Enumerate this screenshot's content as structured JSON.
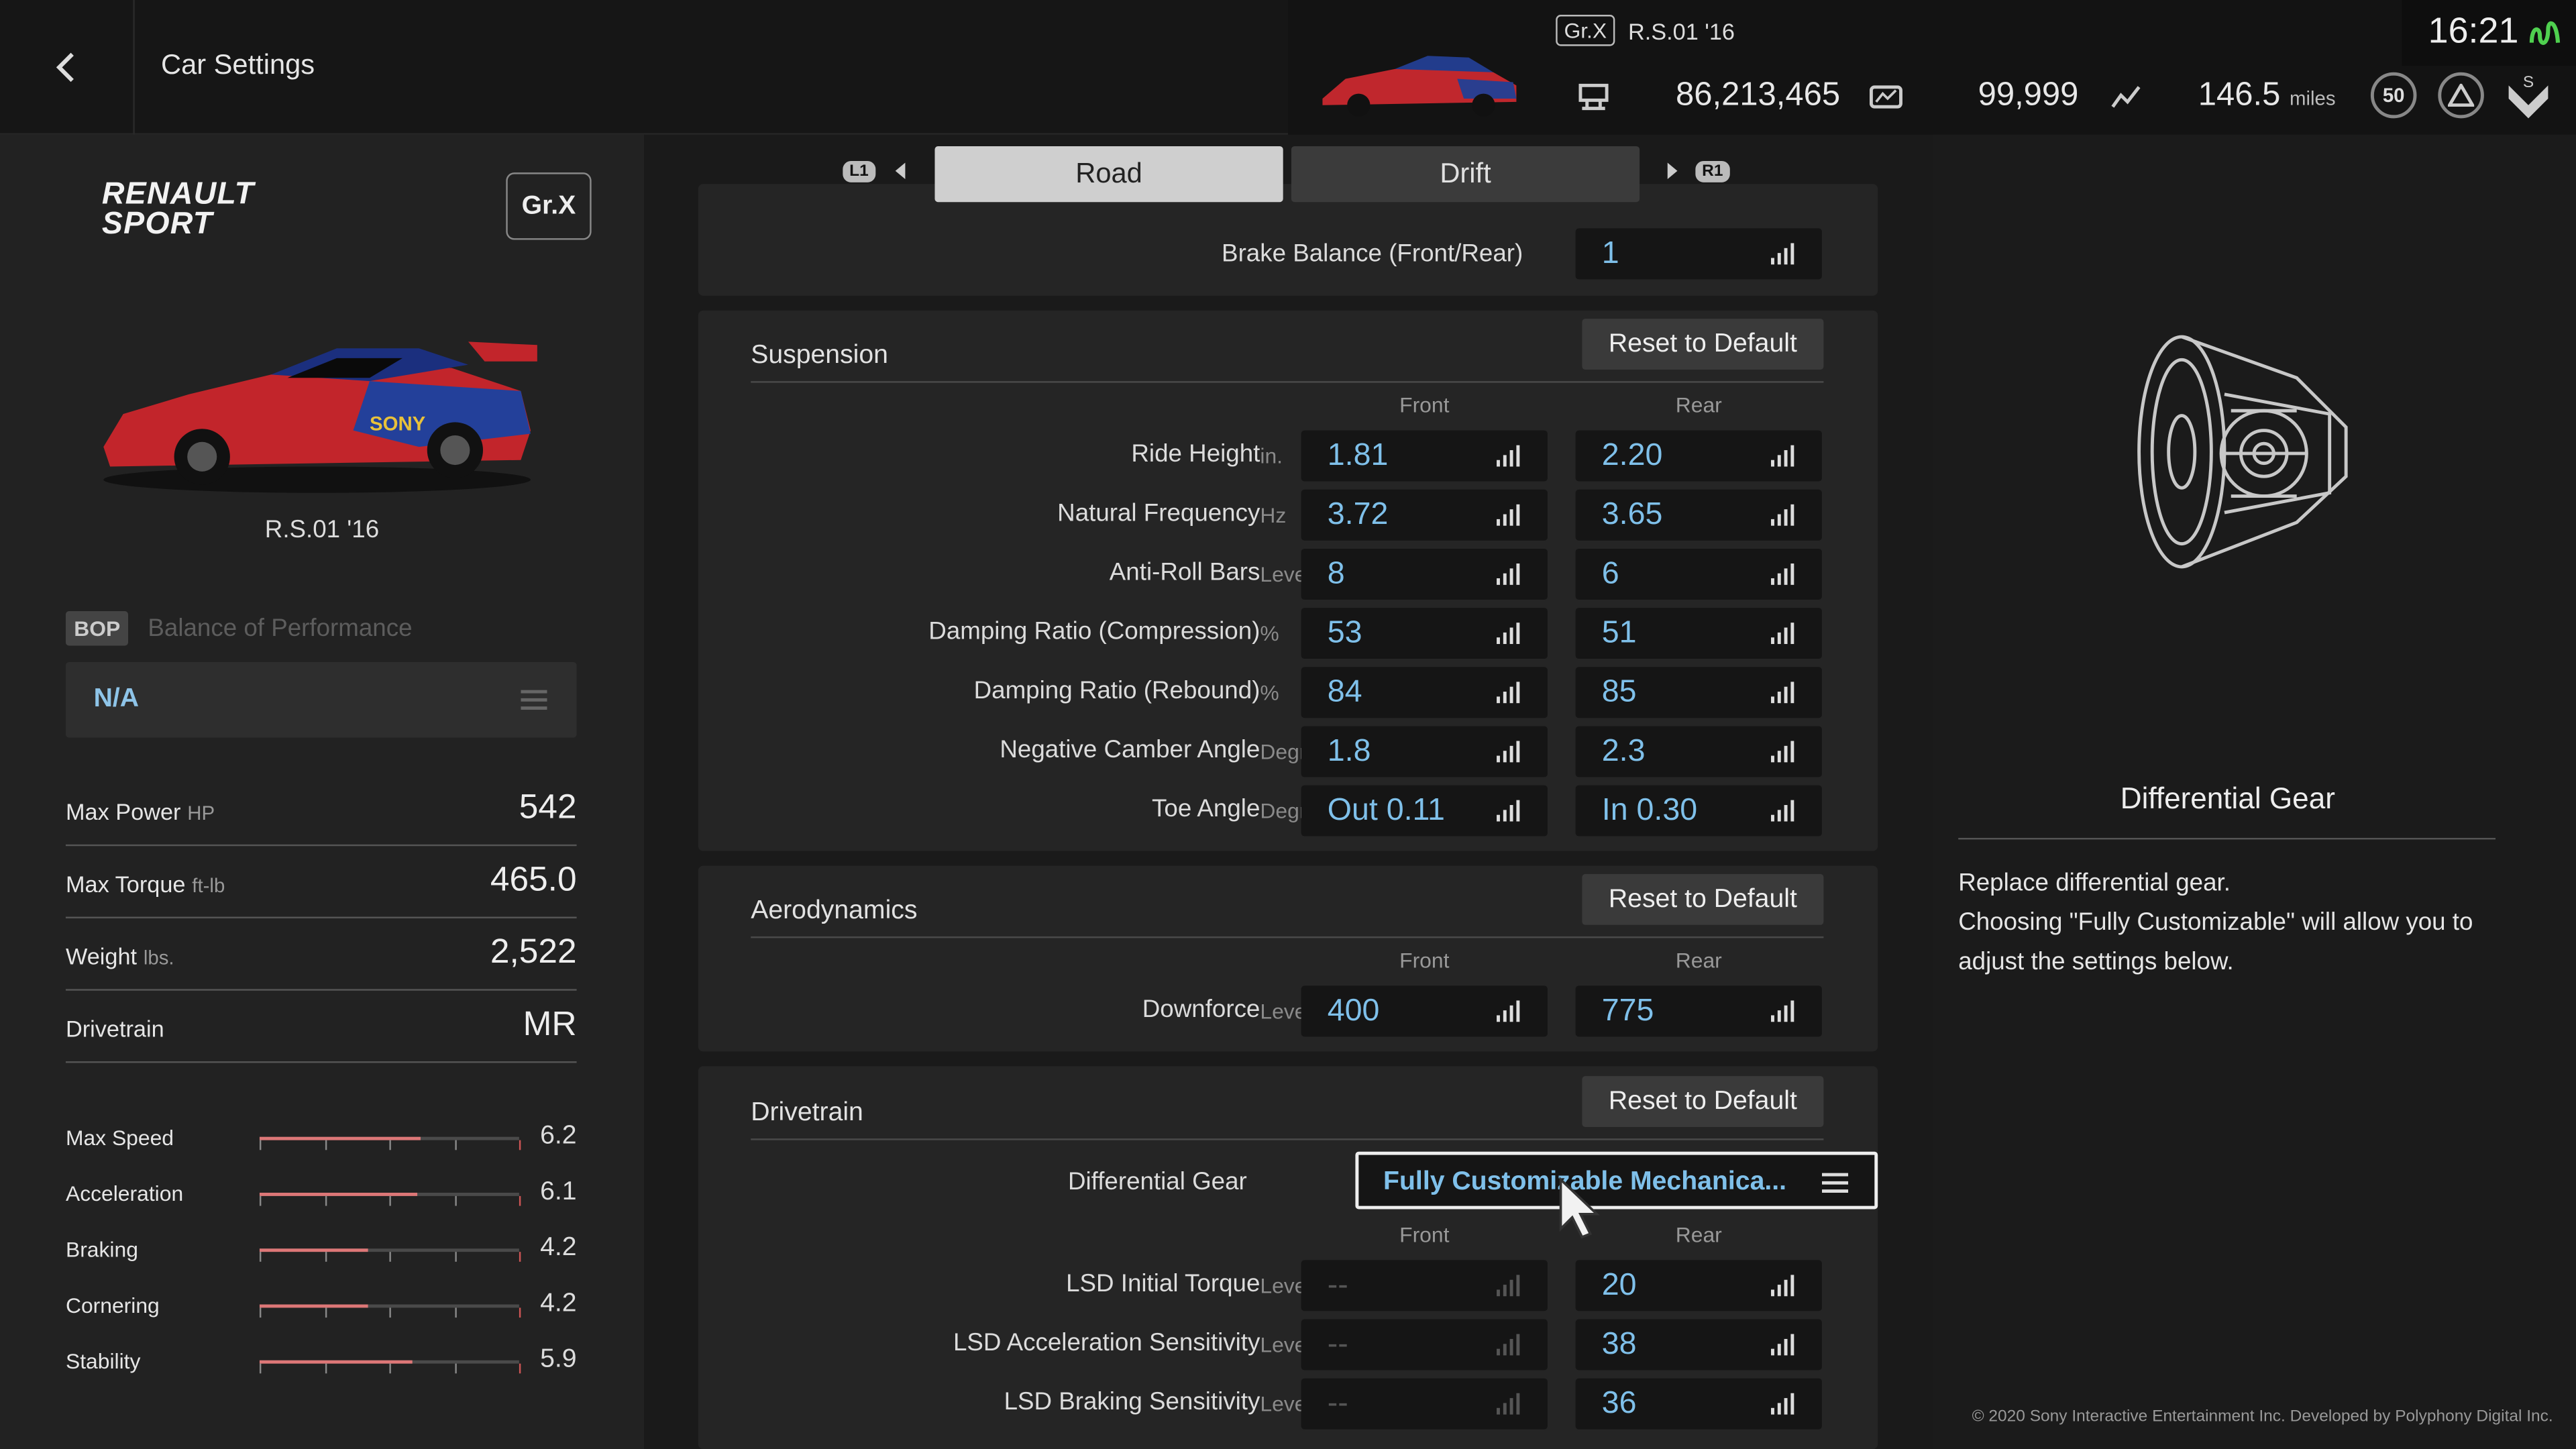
{
  "header": {
    "title": "Car Settings"
  },
  "info_bar": {
    "class_badge": "Gr.X",
    "car_name": "R.S.01 '16",
    "credits": "86,213,465",
    "mileage_points": "99,999",
    "distance": "146.5",
    "distance_unit": "miles",
    "level": "50",
    "clock": "16:21"
  },
  "left_panel": {
    "brand_line1": "RENAULT",
    "brand_line2": "SPORT",
    "class_badge": "Gr.X",
    "car_model": "R.S.01 '16",
    "bop_tag": "BOP",
    "bop_label": "Balance of Performance",
    "bop_value": "N/A",
    "specs": [
      {
        "label": "Max Power",
        "unit": "HP",
        "value": "542"
      },
      {
        "label": "Max Torque",
        "unit": "ft-lb",
        "value": "465.0"
      },
      {
        "label": "Weight",
        "unit": "lbs.",
        "value": "2,522"
      },
      {
        "label": "Drivetrain",
        "unit": "",
        "value": "MR"
      }
    ],
    "performance": [
      {
        "label": "Max Speed",
        "value": "6.2",
        "level": 0.62
      },
      {
        "label": "Acceleration",
        "value": "6.1",
        "level": 0.61
      },
      {
        "label": "Braking",
        "value": "4.2",
        "level": 0.42
      },
      {
        "label": "Cornering",
        "value": "4.2",
        "level": 0.42
      },
      {
        "label": "Stability",
        "value": "5.9",
        "level": 0.59
      }
    ]
  },
  "tabs": {
    "left_button": "L1",
    "road": "Road",
    "drift": "Drift",
    "right_button": "R1"
  },
  "brakes": {
    "label": "Brake Balance (Front/Rear)",
    "value": "1"
  },
  "suspension": {
    "title": "Suspension",
    "reset": "Reset to Default",
    "front": "Front",
    "rear": "Rear",
    "rows": [
      {
        "label": "Ride Height",
        "unit": "in.",
        "front": "1.81",
        "rear": "2.20"
      },
      {
        "label": "Natural Frequency",
        "unit": "Hz",
        "front": "3.72",
        "rear": "3.65"
      },
      {
        "label": "Anti-Roll Bars",
        "unit": "Level",
        "front": "8",
        "rear": "6"
      },
      {
        "label": "Damping Ratio (Compression)",
        "unit": "%",
        "front": "53",
        "rear": "51"
      },
      {
        "label": "Damping Ratio (Rebound)",
        "unit": "%",
        "front": "84",
        "rear": "85"
      },
      {
        "label": "Negative Camber Angle",
        "unit": "Degrees",
        "front": "1.8",
        "rear": "2.3"
      },
      {
        "label": "Toe Angle",
        "unit": "Degrees",
        "front": "Out 0.11",
        "rear": "In 0.30"
      }
    ]
  },
  "aerodynamics": {
    "title": "Aerodynamics",
    "reset": "Reset to Default",
    "front": "Front",
    "rear": "Rear",
    "rows": [
      {
        "label": "Downforce",
        "unit": "Level",
        "front": "400",
        "rear": "775"
      }
    ]
  },
  "drivetrain": {
    "title": "Drivetrain",
    "reset": "Reset to Default",
    "diff_label": "Differential Gear",
    "diff_value": "Fully Customizable Mechanica...",
    "front": "Front",
    "rear": "Rear",
    "rows": [
      {
        "label": "LSD Initial Torque",
        "unit": "Level",
        "front": "--",
        "rear": "20"
      },
      {
        "label": "LSD Acceleration Sensitivity",
        "unit": "Level",
        "front": "--",
        "rear": "38"
      },
      {
        "label": "LSD Braking Sensitivity",
        "unit": "Level",
        "front": "--",
        "rear": "36"
      }
    ]
  },
  "right_panel": {
    "title": "Differential Gear",
    "description": "Replace differential gear.\nChoosing \"Fully Customizable\" will allow you to adjust the settings below."
  },
  "footer": {
    "copyright": "© 2020 Sony Interactive Entertainment Inc. Developed by Polyphony Digital Inc."
  },
  "colors": {
    "accent_value": "#7fc0ea",
    "selected_tab": "#cfcfcf",
    "perf_bar": "#dd7777"
  }
}
